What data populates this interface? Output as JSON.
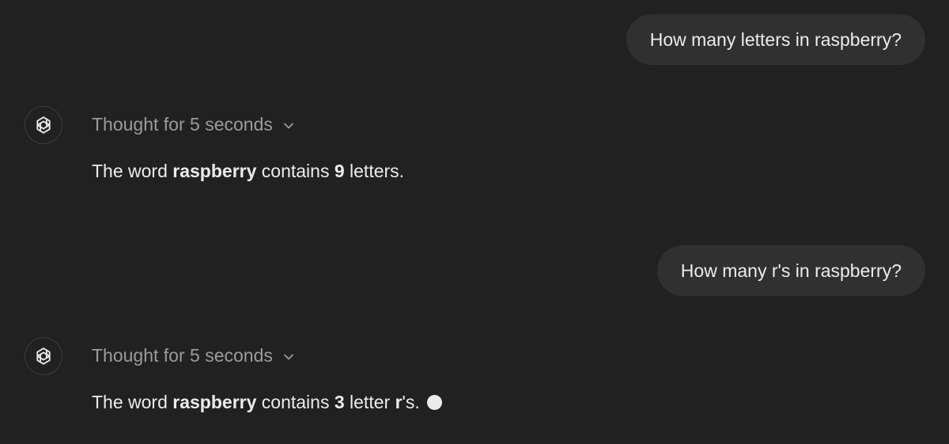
{
  "messages": [
    {
      "role": "user",
      "text": "How many letters in raspberry?"
    },
    {
      "role": "assistant",
      "avatar_icon": "openai-logo-icon",
      "thought_label": "Thought for 5 seconds",
      "answer": {
        "prefix": "The word ",
        "word": "raspberry",
        "middle": " contains ",
        "number": "9",
        "suffix": " letters."
      }
    },
    {
      "role": "user",
      "text": "How many r's in raspberry?"
    },
    {
      "role": "assistant",
      "avatar_icon": "openai-logo-icon",
      "thought_label": "Thought for 5 seconds",
      "answer": {
        "prefix": "The word ",
        "word": "raspberry",
        "middle": " contains ",
        "number": "3",
        "mid2": " letter ",
        "letter": "r",
        "suffix": "'s."
      },
      "streaming_indicator": "white-dot-icon"
    }
  ],
  "colors": {
    "background": "#212121",
    "user_bubble": "#303030",
    "text": "#ececec",
    "muted_text": "#9b9b9b"
  }
}
